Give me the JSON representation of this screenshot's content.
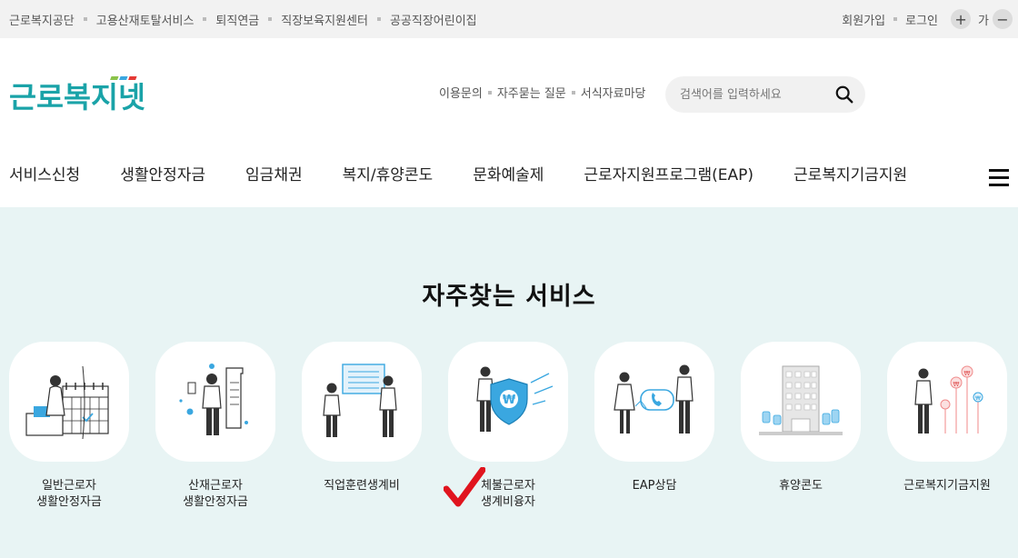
{
  "topbar": {
    "links": [
      "근로복지공단",
      "고용산재토탈서비스",
      "퇴직연금",
      "직장보육지원센터",
      "공공직장어린이집"
    ],
    "join": "회원가입",
    "login": "로그인",
    "font_plus": "+",
    "font_label": "가",
    "font_minus": "−"
  },
  "header": {
    "logo_text": "근로복지넷",
    "subnav": [
      "이용문의",
      "자주묻는 질문",
      "서식자료마당"
    ],
    "search_placeholder": "검색어를 입력하세요"
  },
  "nav": [
    "서비스신청",
    "생활안정자금",
    "임금채권",
    "복지/휴양콘도",
    "문화예술제",
    "근로자지원프로그램(EAP)",
    "근로복지기금지원"
  ],
  "frequent": {
    "title": "자주찾는 서비스",
    "services": [
      {
        "line1": "일반근로자",
        "line2": "생활안정자금"
      },
      {
        "line1": "산재근로자",
        "line2": "생활안정자금"
      },
      {
        "line1": "직업훈련생계비",
        "line2": ""
      },
      {
        "line1": "체불근로자",
        "line2": "생계비융자"
      },
      {
        "line1": "EAP상담",
        "line2": ""
      },
      {
        "line1": "휴양콘도",
        "line2": ""
      },
      {
        "line1": "근로복지기금지원",
        "line2": ""
      }
    ]
  },
  "colors": {
    "teal": "#1aa3a8",
    "accent_red": "#e0141e",
    "bg_mint": "#e8f4f4",
    "icon_blue": "#3aa7e0"
  }
}
